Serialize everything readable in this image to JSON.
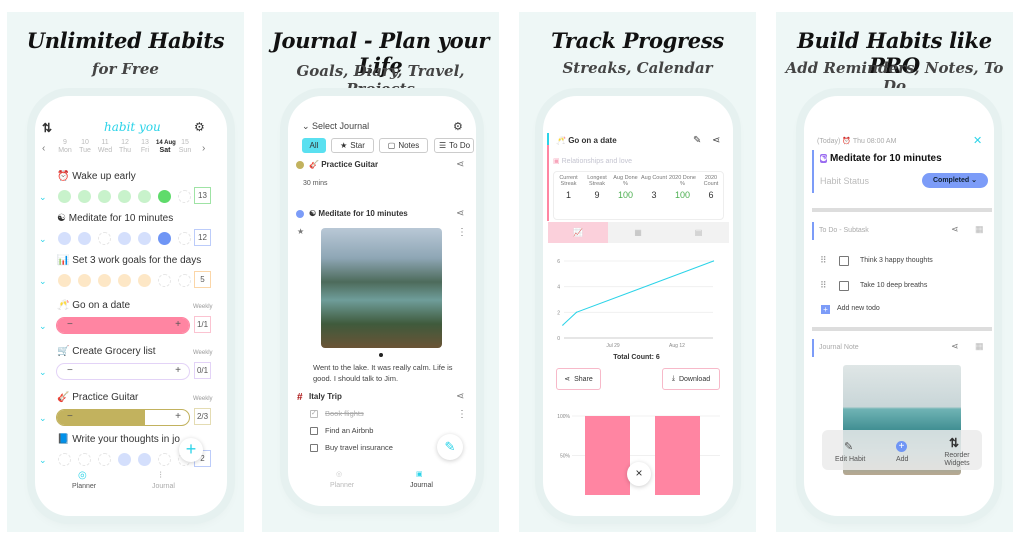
{
  "colors": {
    "panel_bg": "#eef7f6",
    "accent_cyan": "#2bd3e8",
    "pink": "#ff85a2",
    "olive": "#c2b25e",
    "blue": "#6f95f5",
    "green": "#5fdb6b"
  },
  "panel1": {
    "title": "Unlimited Habits",
    "subtitle": "for Free",
    "logo": "habit you",
    "days": [
      {
        "d": "9",
        "w": "Mon"
      },
      {
        "d": "10",
        "w": "Tue"
      },
      {
        "d": "11",
        "w": "Wed"
      },
      {
        "d": "12",
        "w": "Thu"
      },
      {
        "d": "13",
        "w": "Fri"
      },
      {
        "d": "14 Aug",
        "w": "Sat"
      },
      {
        "d": "15",
        "w": "Sun"
      }
    ],
    "habits": [
      {
        "icon": "⏰",
        "name": "Wake up early",
        "count": "13"
      },
      {
        "icon": "☯",
        "name": "Meditate for 10 minutes",
        "count": "12"
      },
      {
        "icon": "📊",
        "name": "Set 3 work goals for the days",
        "count": "5"
      },
      {
        "icon": "🥂",
        "name": "Go on a date",
        "freq": "Weekly",
        "count": "1/1",
        "progress": 1.0
      },
      {
        "icon": "🛒",
        "name": "Create Grocery list",
        "freq": "Weekly",
        "count": "0/1",
        "progress": 0.0
      },
      {
        "icon": "🎸",
        "name": "Practice Guitar",
        "freq": "Weekly",
        "count": "2/3",
        "progress": 0.67
      },
      {
        "icon": "📘",
        "name": "Write your thoughts in jo",
        "count": "2"
      }
    ],
    "minus": "−",
    "plus": "+",
    "prev": "‹",
    "next": "›",
    "nav": {
      "planner": "Planner",
      "journal": "Journal"
    }
  },
  "panel2": {
    "title": "Journal - Plan your Life",
    "subtitle": "Goals, Diary, Travel, Projects",
    "select": "Select Journal",
    "filters": [
      "All",
      "Star",
      "Notes",
      "To Do"
    ],
    "entries": [
      {
        "name": "Practice Guitar",
        "detail": "30 mins"
      },
      {
        "name": "Meditate for 10 minutes",
        "text": "Went to the lake. It was really calm. Life is good. I should talk to Jim."
      }
    ],
    "trip": {
      "name": "Italy Trip",
      "todos": [
        {
          "label": "Book flights",
          "done": true
        },
        {
          "label": "Find an Airbnb",
          "done": false
        },
        {
          "label": "Buy travel insurance",
          "done": false
        }
      ]
    },
    "nav": {
      "planner": "Planner",
      "journal": "Journal"
    }
  },
  "panel3": {
    "title": "Track Progress",
    "subtitle": "Streaks, Calendar",
    "habit": "Go on a date",
    "category": "Relationships and love",
    "stats": [
      {
        "label": "Current Streak",
        "value": "1"
      },
      {
        "label": "Longest Streak",
        "value": "9"
      },
      {
        "label": "Aug Done %",
        "value": "100"
      },
      {
        "label": "Aug Count",
        "value": "3"
      },
      {
        "label": "2020 Done %",
        "value": "100"
      },
      {
        "label": "2020 Count",
        "value": "6"
      }
    ],
    "total": "Total Count: 6",
    "share": "Share",
    "download": "Download",
    "close": "×"
  },
  "chart_data": [
    {
      "type": "line",
      "x": [
        "2020-07-18",
        "2020-07-21",
        "2020-08-20"
      ],
      "values": [
        1,
        2,
        6
      ],
      "ylim": [
        0,
        6
      ],
      "yticks": [
        "0",
        "2",
        "4",
        "6"
      ],
      "xticks": [
        "Jul 29",
        "Aug 12"
      ],
      "grid": true
    },
    {
      "type": "bar",
      "values": [
        100,
        100
      ],
      "yticks": [
        "50%",
        "100%"
      ],
      "grid": true
    }
  ],
  "panel4": {
    "title": "Build Habits like PRO",
    "subtitle": "Add Reminders, Notes, To Do",
    "today": "(Today)",
    "time": "Thu 08:00 AM",
    "habit": "Meditate for 10 minutes",
    "status_label": "Habit Status",
    "status": "Completed",
    "todo_title": "To Do - Subtask",
    "todos": [
      "Think 3 happy thoughts",
      "Take 10 deep breaths"
    ],
    "add_todo": "Add new todo",
    "note_title": "Journal Note",
    "actions": [
      "Edit Habit",
      "Add",
      "Reorder Widgets"
    ]
  }
}
